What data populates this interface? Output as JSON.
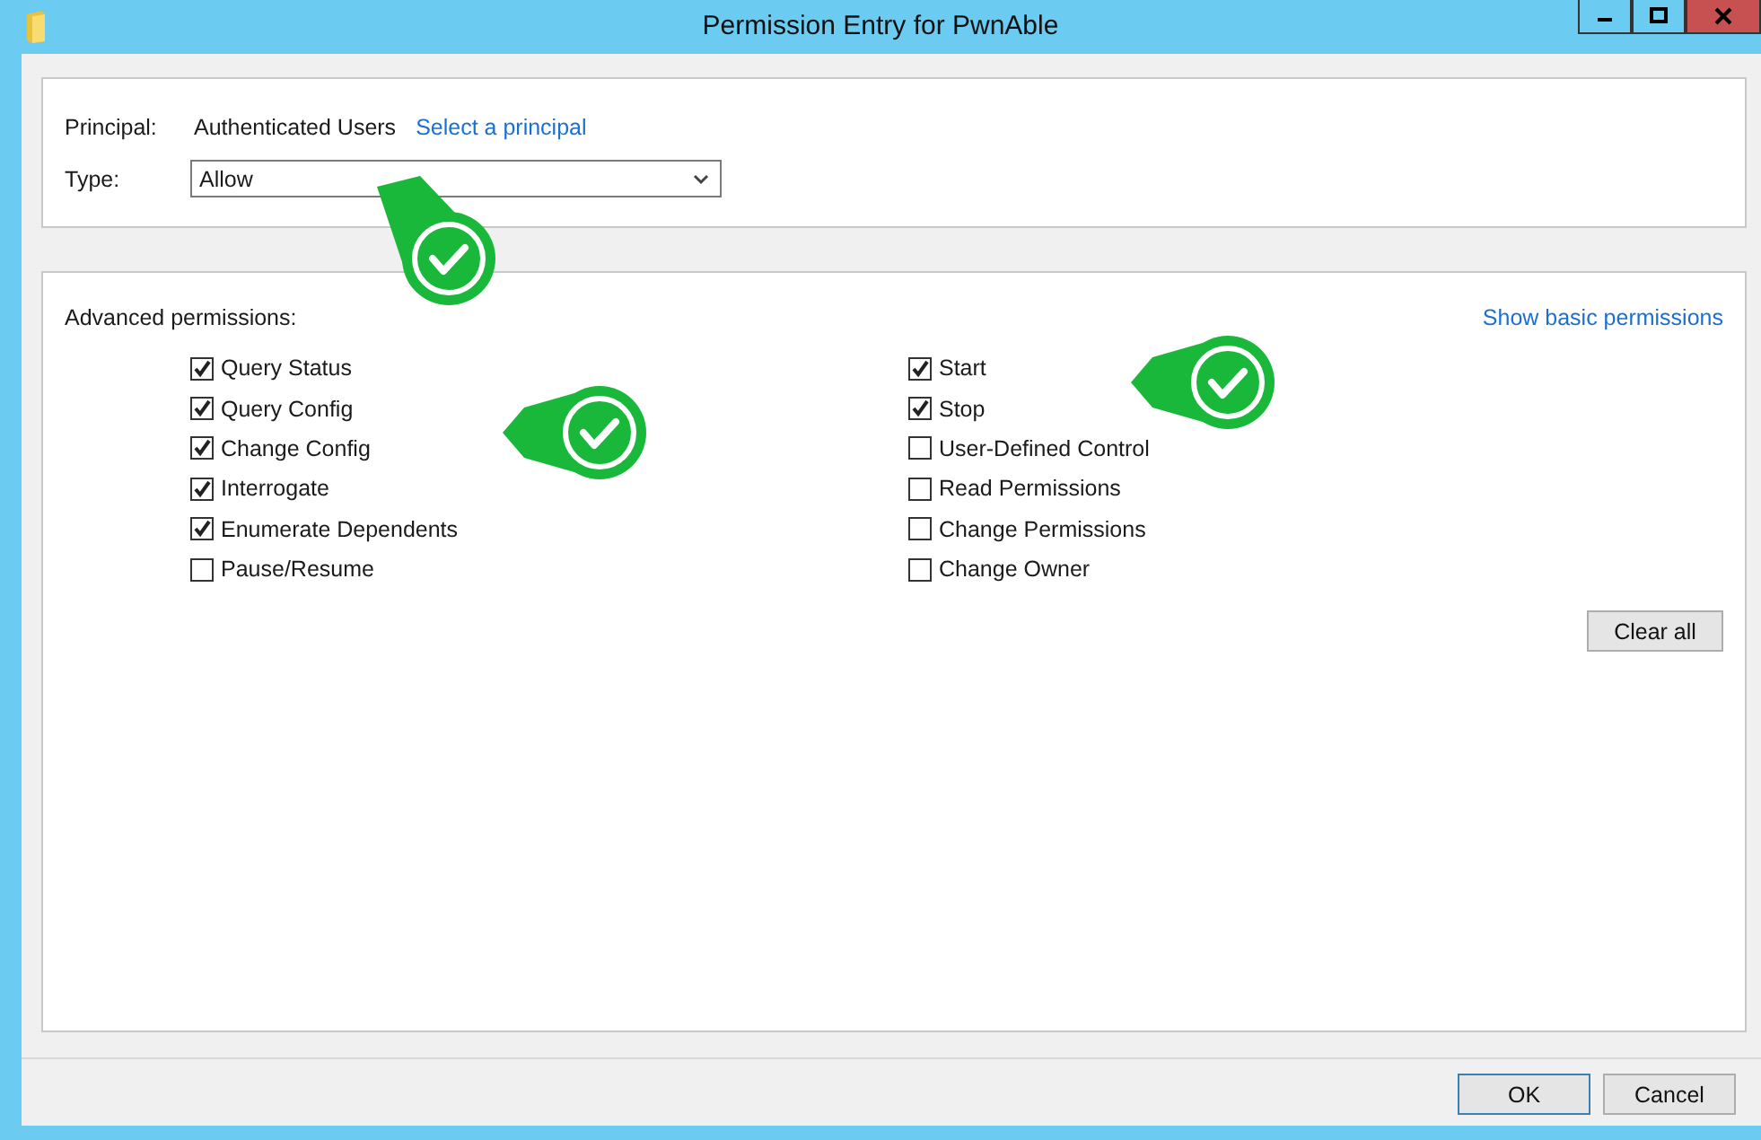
{
  "window": {
    "title": "Permission Entry for PwnAble"
  },
  "principal": {
    "label": "Principal:",
    "value": "Authenticated Users",
    "link": "Select a principal"
  },
  "type": {
    "label": "Type:",
    "value": "Allow"
  },
  "advanced": {
    "label": "Advanced permissions:",
    "link": "Show basic permissions",
    "columns": [
      [
        {
          "label": "Query Status",
          "checked": true
        },
        {
          "label": "Query Config",
          "checked": true
        },
        {
          "label": "Change Config",
          "checked": true
        },
        {
          "label": "Interrogate",
          "checked": true
        },
        {
          "label": "Enumerate Dependents",
          "checked": true
        },
        {
          "label": "Pause/Resume",
          "checked": false
        }
      ],
      [
        {
          "label": "Start",
          "checked": true
        },
        {
          "label": "Stop",
          "checked": true
        },
        {
          "label": "User-Defined Control",
          "checked": false
        },
        {
          "label": "Read Permissions",
          "checked": false
        },
        {
          "label": "Change Permissions",
          "checked": false
        },
        {
          "label": "Change Owner",
          "checked": false
        }
      ]
    ]
  },
  "clear_button": "Clear all",
  "buttons": [
    {
      "label": "OK",
      "default": true
    },
    {
      "label": "Cancel",
      "default": false
    }
  ]
}
